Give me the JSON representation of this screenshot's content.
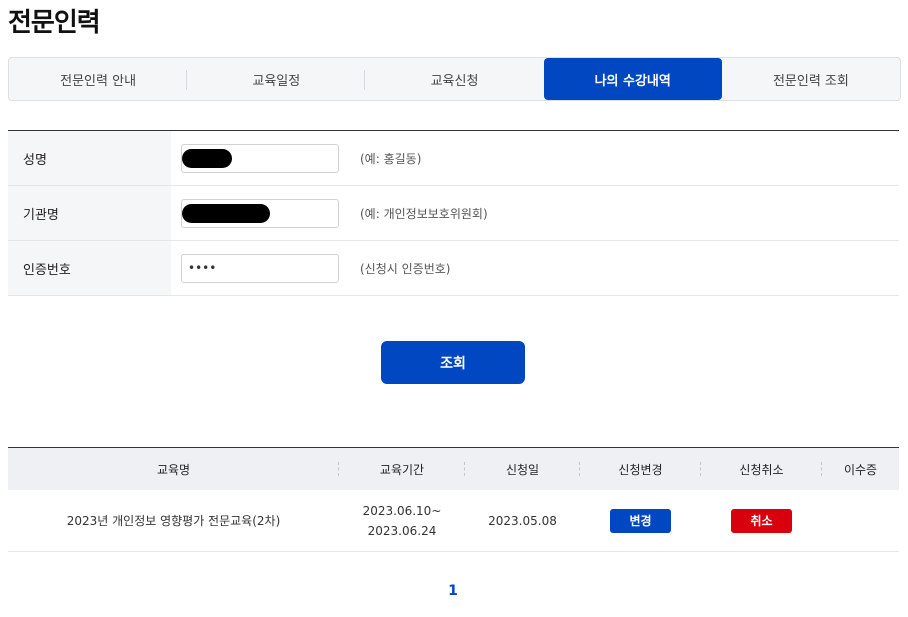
{
  "page": {
    "title": "전문인력"
  },
  "tabs": [
    {
      "label": "전문인력 안내",
      "active": false
    },
    {
      "label": "교육일정",
      "active": false
    },
    {
      "label": "교육신청",
      "active": false
    },
    {
      "label": "나의 수강내역",
      "active": true
    },
    {
      "label": "전문인력 조회",
      "active": false
    }
  ],
  "form": {
    "name": {
      "label": "성명",
      "value": "",
      "hint": "(예: 홍길동)"
    },
    "org": {
      "label": "기관명",
      "value": "",
      "hint": "(예: 개인정보보호위원회)"
    },
    "auth": {
      "label": "인증번호",
      "value": "••••",
      "hint": "(신청시 인증번호)"
    }
  },
  "search_button": {
    "label": "조회"
  },
  "results": {
    "headers": [
      "교육명",
      "교육기간",
      "신청일",
      "신청변경",
      "신청취소",
      "이수증"
    ],
    "rows": [
      {
        "course": "2023년 개인정보 영향평가 전문교육(2차)",
        "period_start": "2023.06.10~",
        "period_end": "2023.06.24",
        "applied": "2023.05.08",
        "change_label": "변경",
        "cancel_label": "취소",
        "certificate": ""
      }
    ]
  },
  "pagination": {
    "current": "1"
  },
  "colors": {
    "primary": "#0047c1",
    "danger": "#d9000d"
  }
}
